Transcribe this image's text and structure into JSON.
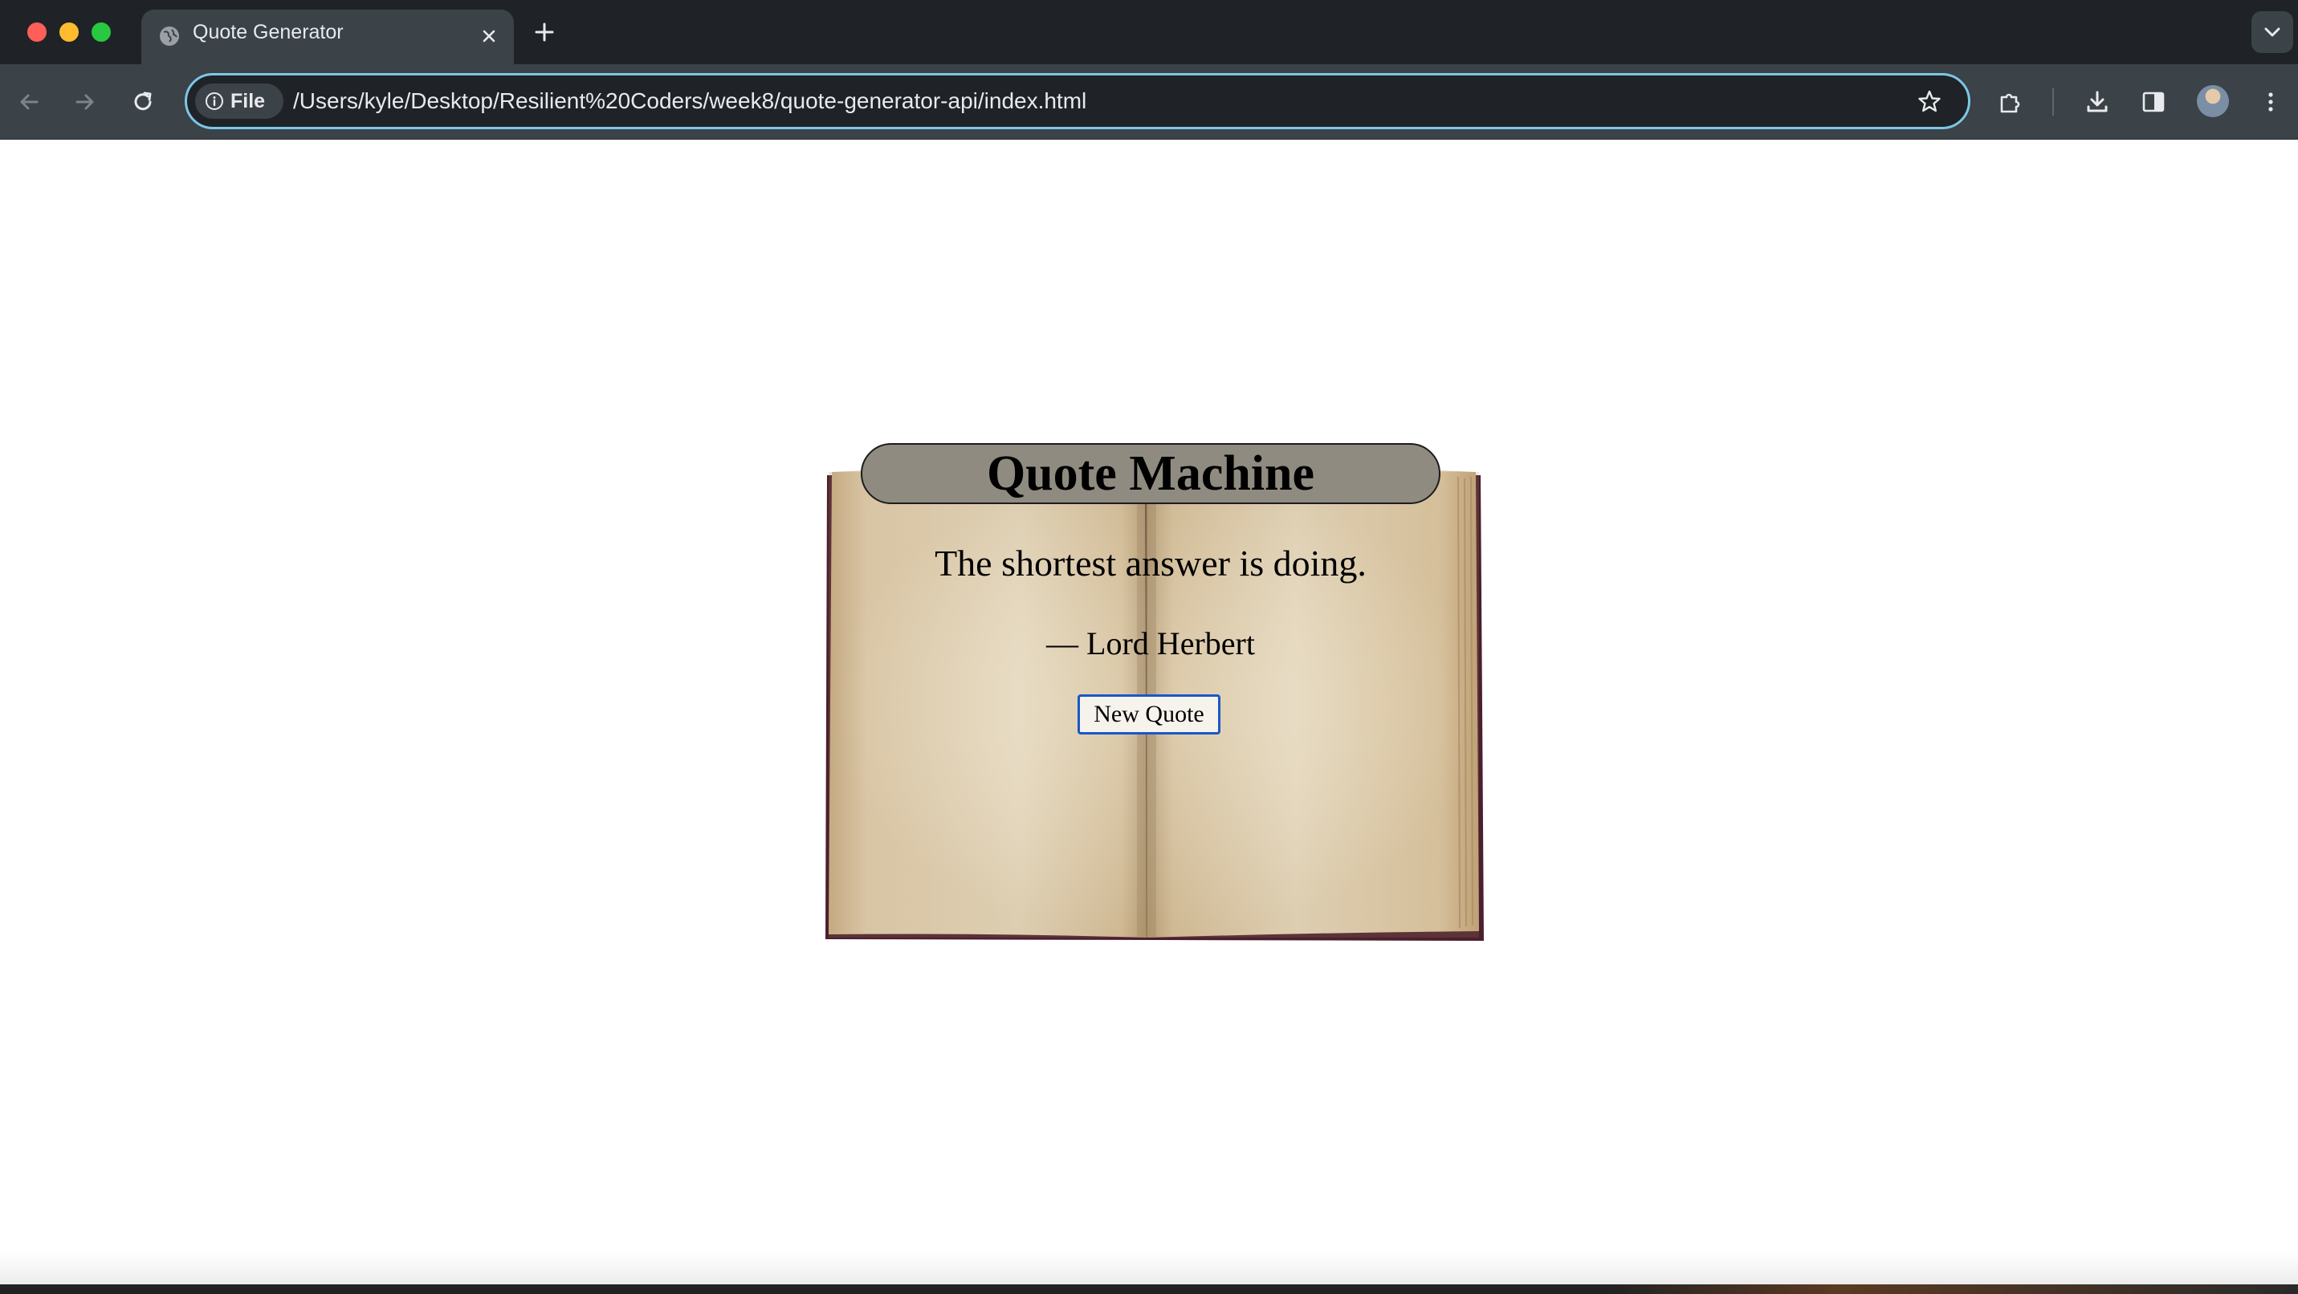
{
  "browser": {
    "tab": {
      "title": "Quote Generator",
      "favicon": "globe-icon",
      "close_icon": "close-icon"
    },
    "new_tab_icon": "plus-icon",
    "tab_search_icon": "chevron-down-icon",
    "toolbar": {
      "back_icon": "arrow-left-icon",
      "forward_icon": "arrow-right-icon",
      "reload_icon": "reload-icon",
      "extensions_icon": "puzzle-icon",
      "download_icon": "download-icon",
      "side_panel_icon": "side-panel-icon",
      "menu_icon": "kebab-menu-icon"
    },
    "omnibox": {
      "chip_label": "File",
      "chip_icon": "info-icon",
      "url": "/Users/kyle/Desktop/Resilient%20Coders/week8/quote-generator-api/index.html",
      "bookmark_icon": "star-icon"
    },
    "colors": {
      "tabstrip": "#1f2327",
      "toolbar": "#3b4248",
      "omnibox_focus": "#7cc7e6"
    }
  },
  "page": {
    "heading": "Quote Machine",
    "quote": "The shortest answer is doing.",
    "author": "— Lord Herbert",
    "button_label": "New Quote",
    "colors": {
      "heading_pill": "#8f8b80",
      "button_border": "#1a57c8"
    }
  }
}
